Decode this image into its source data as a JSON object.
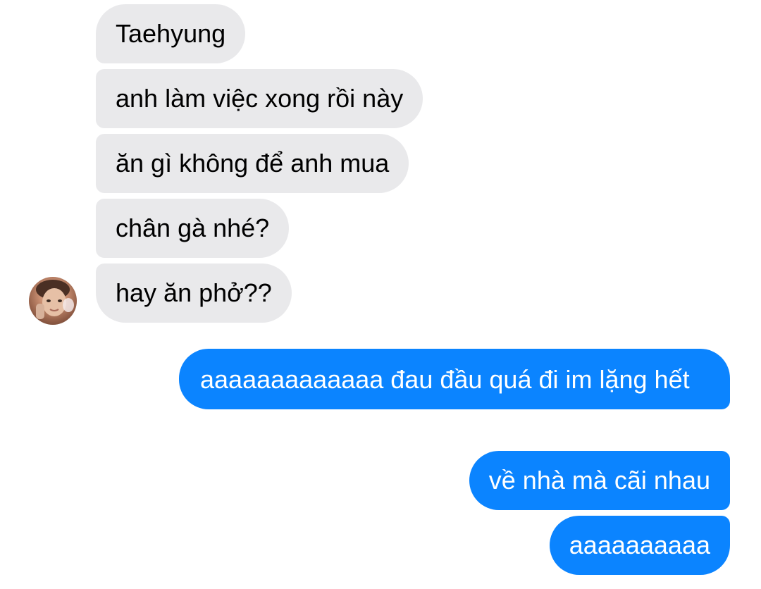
{
  "conversation": {
    "incoming": [
      "Taehyung",
      "anh làm việc xong rồi này",
      "ăn gì không để anh mua",
      "chân gà nhé?",
      "hay ăn phở??"
    ],
    "outgoing": [
      "aaaaaaaaaaaaa đau đầu quá đi im lặng hết",
      "về nhà mà cãi nhau",
      "aaaaaaaaaa"
    ]
  },
  "colors": {
    "incoming_bubble": "#e9e9eb",
    "outgoing_bubble": "#0b84ff",
    "outgoing_text": "#ffffff"
  },
  "avatar": {
    "icon": "profile-photo"
  }
}
